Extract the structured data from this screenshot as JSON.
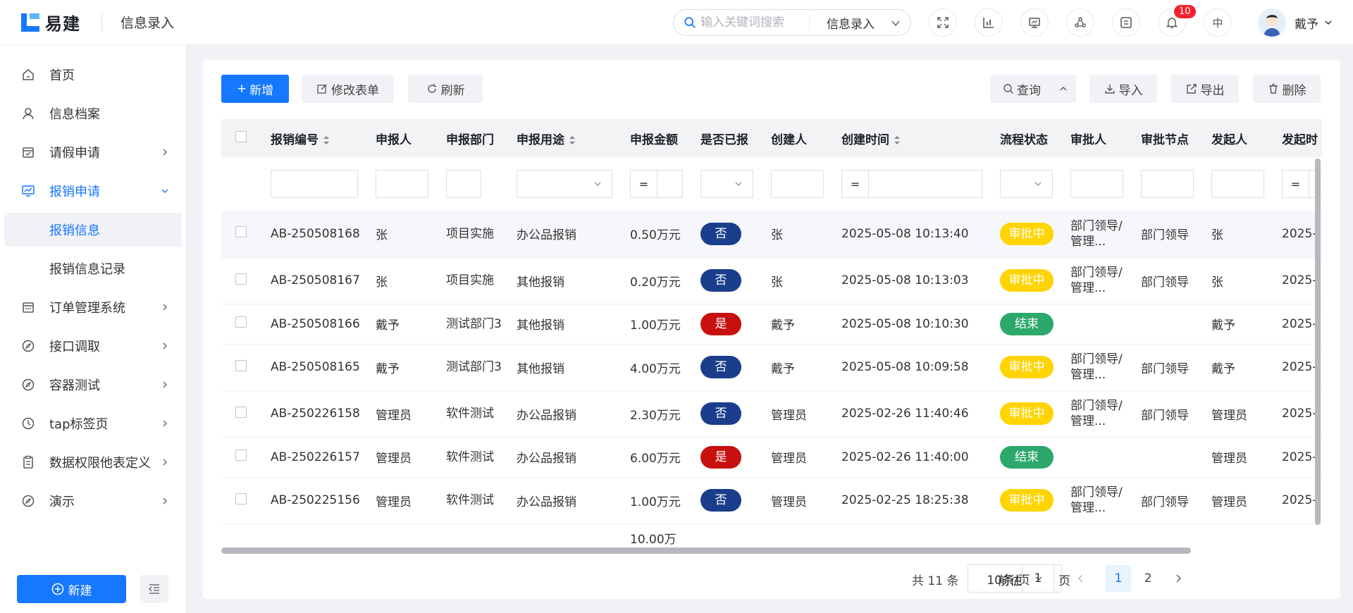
{
  "header": {
    "logo_text": "易建",
    "title": "信息录入",
    "search_placeholder": "输入关键词搜索",
    "search_scope": "信息录入",
    "notification_count": "10",
    "lang_label": "中",
    "user_name": "戴予"
  },
  "sidebar": {
    "items": [
      {
        "label": "首页"
      },
      {
        "label": "信息档案"
      },
      {
        "label": "请假申请"
      },
      {
        "label": "报销申请"
      },
      {
        "label": "报销信息"
      },
      {
        "label": "报销信息记录"
      },
      {
        "label": "订单管理系统"
      },
      {
        "label": "接口调取"
      },
      {
        "label": "容器测试"
      },
      {
        "label": "tap标签页"
      },
      {
        "label": "数据权限他表定义"
      },
      {
        "label": "演示"
      }
    ],
    "new_button": "新建"
  },
  "toolbar": {
    "add": "新增",
    "edit_form": "修改表单",
    "refresh": "刷新",
    "query": "查询",
    "import": "导入",
    "export": "导出",
    "delete": "删除"
  },
  "table": {
    "columns": [
      "报销编号",
      "申报人",
      "申报部门",
      "申报用途",
      "申报金额",
      "是否已报",
      "创建人",
      "创建时间",
      "流程状态",
      "审批人",
      "审批节点",
      "发起人",
      "发起时"
    ],
    "filter_eq": "=",
    "rows": [
      {
        "id": "AB-250508168",
        "applicant": "张",
        "dept": "项目实施",
        "purpose": "办公品报销",
        "amount": "0.50万元",
        "reported": "否",
        "creator": "张",
        "created": "2025-05-08 10:13:40",
        "status": "审批中",
        "approver": "部门领导/管理...",
        "node": "部门领导",
        "initiator": "张",
        "initiated": "2025-"
      },
      {
        "id": "AB-250508167",
        "applicant": "张",
        "dept": "项目实施",
        "purpose": "其他报销",
        "amount": "0.20万元",
        "reported": "否",
        "creator": "张",
        "created": "2025-05-08 10:13:03",
        "status": "审批中",
        "approver": "部门领导/管理...",
        "node": "部门领导",
        "initiator": "张",
        "initiated": "2025-"
      },
      {
        "id": "AB-250508166",
        "applicant": "戴予",
        "dept": "测试部门3",
        "purpose": "其他报销",
        "amount": "1.00万元",
        "reported": "是",
        "creator": "戴予",
        "created": "2025-05-08 10:10:30",
        "status": "结束",
        "approver": "",
        "node": "",
        "initiator": "戴予",
        "initiated": "2025-"
      },
      {
        "id": "AB-250508165",
        "applicant": "戴予",
        "dept": "测试部门3",
        "purpose": "其他报销",
        "amount": "4.00万元",
        "reported": "否",
        "creator": "戴予",
        "created": "2025-05-08 10:09:58",
        "status": "审批中",
        "approver": "部门领导/管理...",
        "node": "部门领导",
        "initiator": "戴予",
        "initiated": "2025-"
      },
      {
        "id": "AB-250226158",
        "applicant": "管理员",
        "dept": "软件测试",
        "purpose": "办公品报销",
        "amount": "2.30万元",
        "reported": "否",
        "creator": "管理员",
        "created": "2025-02-26 11:40:46",
        "status": "审批中",
        "approver": "部门领导/管理...",
        "node": "部门领导",
        "initiator": "管理员",
        "initiated": "2025-"
      },
      {
        "id": "AB-250226157",
        "applicant": "管理员",
        "dept": "软件测试",
        "purpose": "办公品报销",
        "amount": "6.00万元",
        "reported": "是",
        "creator": "管理员",
        "created": "2025-02-26 11:40:00",
        "status": "结束",
        "approver": "",
        "node": "",
        "initiator": "管理员",
        "initiated": "2025-"
      },
      {
        "id": "AB-250225156",
        "applicant": "管理员",
        "dept": "软件测试",
        "purpose": "办公品报销",
        "amount": "1.00万元",
        "reported": "否",
        "creator": "管理员",
        "created": "2025-02-25 18:25:38",
        "status": "审批中",
        "approver": "部门领导/管理...",
        "node": "部门领导",
        "initiator": "管理员",
        "initiated": "2025-"
      },
      {
        "id": "",
        "applicant": "",
        "dept": "",
        "purpose": "",
        "amount": "10.00万",
        "reported": "",
        "creator": "",
        "created": "",
        "status": "",
        "approver": "",
        "node": "",
        "initiator": "",
        "initiated": ""
      }
    ]
  },
  "pagination": {
    "total": "共 11 条",
    "page_size": "10条/页",
    "pages": [
      "1",
      "2"
    ],
    "current_page": "1",
    "goto_label": "前往",
    "goto_value": "1",
    "page_suffix": "页"
  },
  "colors": {
    "primary": "#1677ff",
    "pending": "#ffd400",
    "done": "#2ba86a",
    "no": "#1a3e8c",
    "yes": "#c8100f"
  }
}
